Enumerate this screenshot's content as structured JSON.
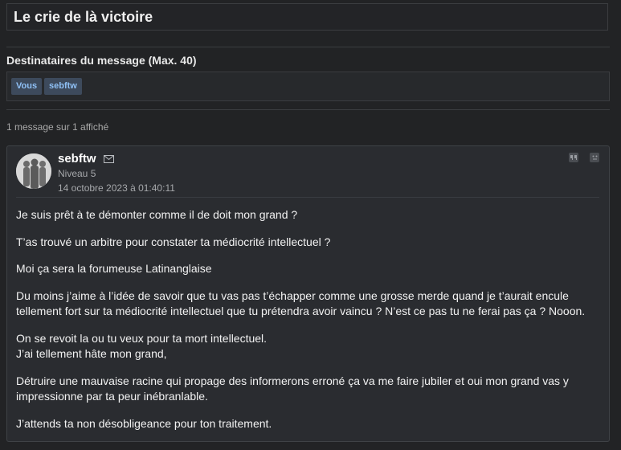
{
  "subject": "Le crie de là victoire",
  "recipients": {
    "label": "Destinataires du message (Max. 40)",
    "tags": [
      "Vous",
      "sebftw"
    ]
  },
  "message_count": "1 message sur 1 affiché",
  "message": {
    "author": "sebftw",
    "level": "Niveau 5",
    "date": "14 octobre 2023 à 01:40:11",
    "paragraphs": [
      "Je suis prêt à te démonter comme il de doit mon grand ?",
      "T’as trouvé un arbitre pour constater ta médiocrité intellectuel ?",
      "Moi ça sera la forumeuse Latinanglaise",
      "Du moins j’aime à l’idée de savoir que tu vas pas t’échapper comme une grosse merde quand je t’aurait encule tellement fort sur ta médiocrité intellectuel que tu prétendra avoir vaincu ? N’est ce pas tu ne ferai pas ça ? Nooon.",
      "On se revoit la ou tu veux pour ta mort intellectuel.\nJ’ai tellement hâte mon grand,",
      "Détruire une mauvaise racine qui propage des informerons erroné ça va me faire jubiler et oui mon grand vas y impressionne par ta peur inébranlable.",
      "J’attends ta non désobligeance pour ton traitement."
    ]
  },
  "icons": {
    "mail": "mail-icon",
    "quote": "quote-icon",
    "report": "report-icon"
  }
}
